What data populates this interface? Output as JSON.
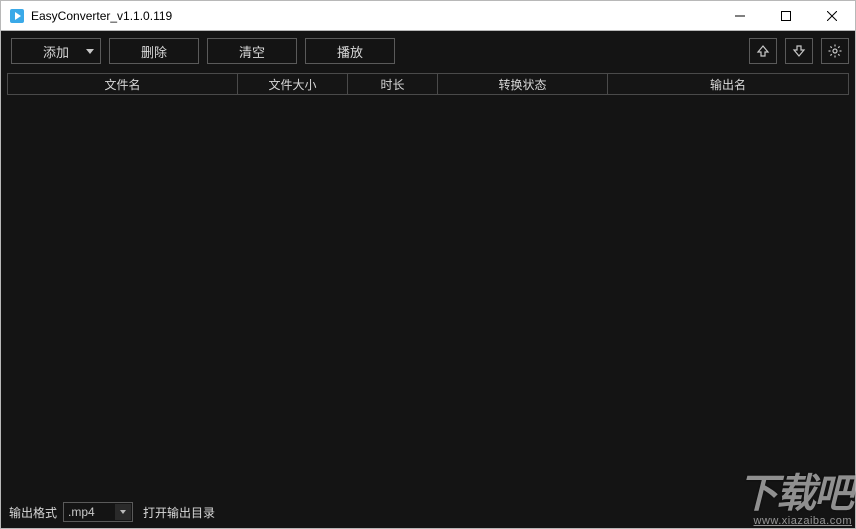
{
  "window": {
    "title": "EasyConverter_v1.1.0.119"
  },
  "toolbar": {
    "add_label": "添加",
    "delete_label": "删除",
    "clear_label": "清空",
    "play_label": "播放"
  },
  "columns": {
    "filename": "文件名",
    "filesize": "文件大小",
    "duration": "时长",
    "status": "转换状态",
    "output": "输出名"
  },
  "rows": [],
  "footer": {
    "format_label": "输出格式",
    "format_value": ".mp4",
    "open_output_label": "打开输出目录"
  },
  "watermark": {
    "brand": "下载吧",
    "url": "www.xiazaiba.com"
  }
}
